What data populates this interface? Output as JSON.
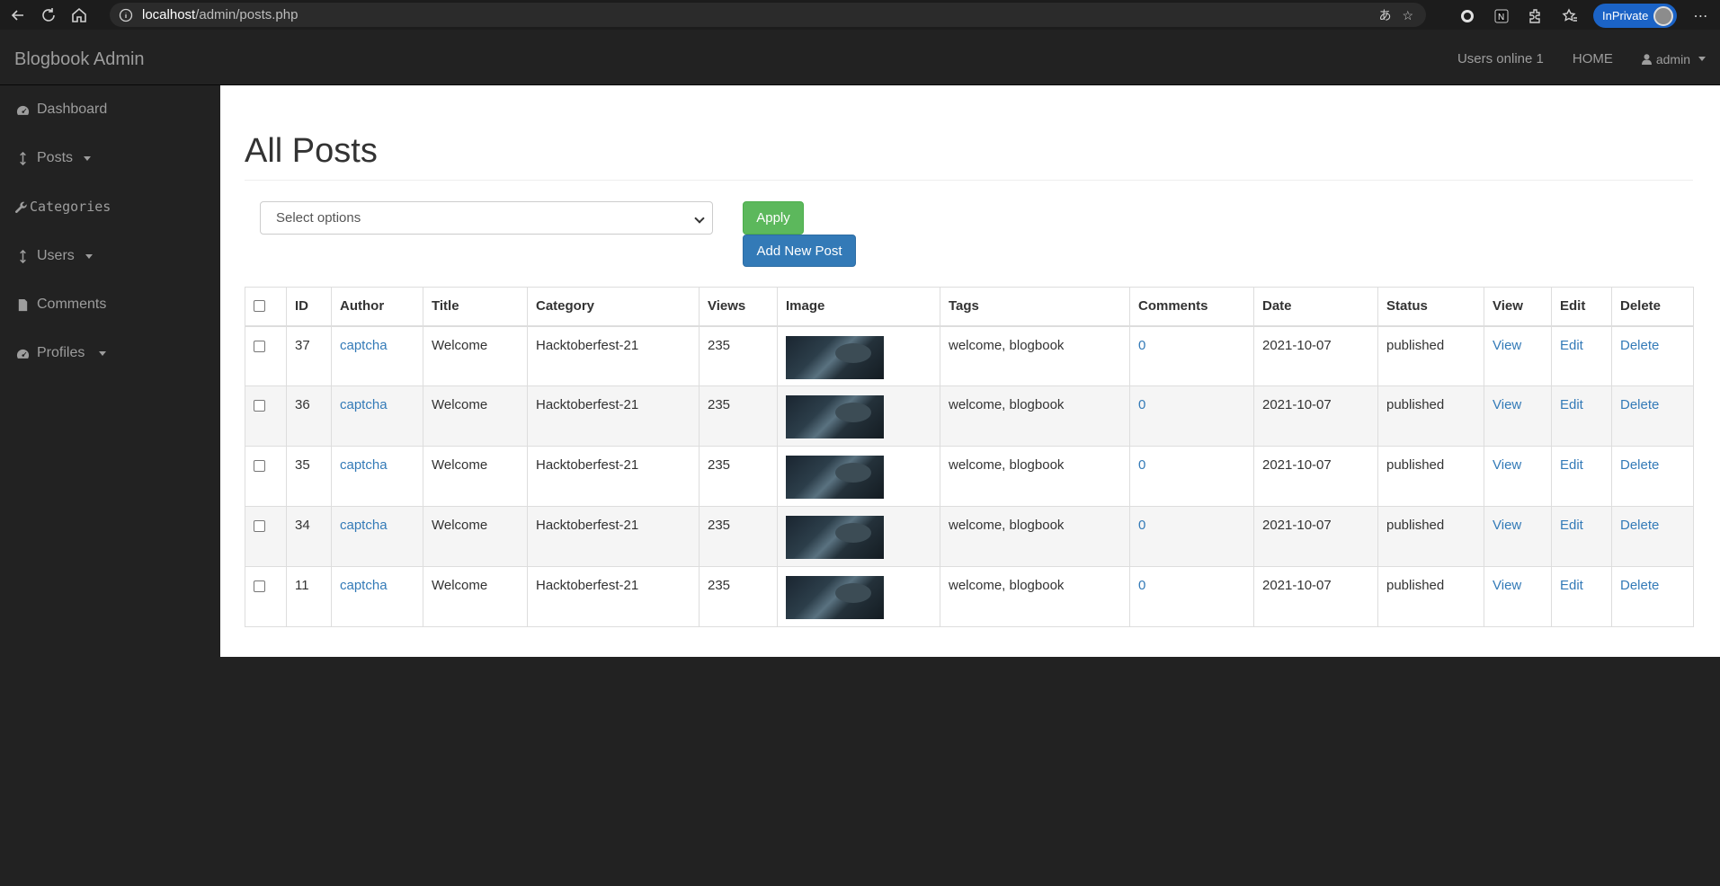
{
  "browser": {
    "url_host": "localhost",
    "url_path": "/admin/posts.php",
    "inprivate_label": "InPrivate"
  },
  "navbar": {
    "brand": "Blogbook Admin",
    "users_online": "Users online 1",
    "home": "HOME",
    "user": "admin"
  },
  "sidebar": {
    "items": [
      {
        "label": "Dashboard",
        "icon": "dashboard-icon"
      },
      {
        "label": "Posts",
        "icon": "arrows-v-icon"
      },
      {
        "label": "Categories",
        "icon": "wrench-icon"
      },
      {
        "label": "Users",
        "icon": "arrows-v-icon"
      },
      {
        "label": "Comments",
        "icon": "file-icon"
      },
      {
        "label": "Profiles",
        "icon": "dashboard-icon"
      }
    ]
  },
  "main": {
    "title": "All Posts",
    "select_placeholder": "Select options",
    "apply_label": "Apply",
    "add_new_label": "Add New Post"
  },
  "table": {
    "headers": [
      "ID",
      "Author",
      "Title",
      "Category",
      "Views",
      "Image",
      "Tags",
      "Comments",
      "Date",
      "Status",
      "View",
      "Edit",
      "Delete"
    ],
    "rows": [
      {
        "id": "37",
        "author": "captcha",
        "title": "Welcome",
        "category": "Hacktoberfest-21",
        "views": "235",
        "tags": "welcome, blogbook",
        "comments": "0",
        "date": "2021-10-07",
        "status": "published",
        "view": "View",
        "edit": "Edit",
        "delete": "Delete"
      },
      {
        "id": "36",
        "author": "captcha",
        "title": "Welcome",
        "category": "Hacktoberfest-21",
        "views": "235",
        "tags": "welcome, blogbook",
        "comments": "0",
        "date": "2021-10-07",
        "status": "published",
        "view": "View",
        "edit": "Edit",
        "delete": "Delete"
      },
      {
        "id": "35",
        "author": "captcha",
        "title": "Welcome",
        "category": "Hacktoberfest-21",
        "views": "235",
        "tags": "welcome, blogbook",
        "comments": "0",
        "date": "2021-10-07",
        "status": "published",
        "view": "View",
        "edit": "Edit",
        "delete": "Delete"
      },
      {
        "id": "34",
        "author": "captcha",
        "title": "Welcome",
        "category": "Hacktoberfest-21",
        "views": "235",
        "tags": "welcome, blogbook",
        "comments": "0",
        "date": "2021-10-07",
        "status": "published",
        "view": "View",
        "edit": "Edit",
        "delete": "Delete"
      },
      {
        "id": "11",
        "author": "captcha",
        "title": "Welcome",
        "category": "Hacktoberfest-21",
        "views": "235",
        "tags": "welcome, blogbook",
        "comments": "0",
        "date": "2021-10-07",
        "status": "published",
        "view": "View",
        "edit": "Edit",
        "delete": "Delete"
      }
    ]
  },
  "colors": {
    "link": "#337ab7",
    "apply": "#5cb85c",
    "add": "#337ab7",
    "navbar": "#222222"
  }
}
